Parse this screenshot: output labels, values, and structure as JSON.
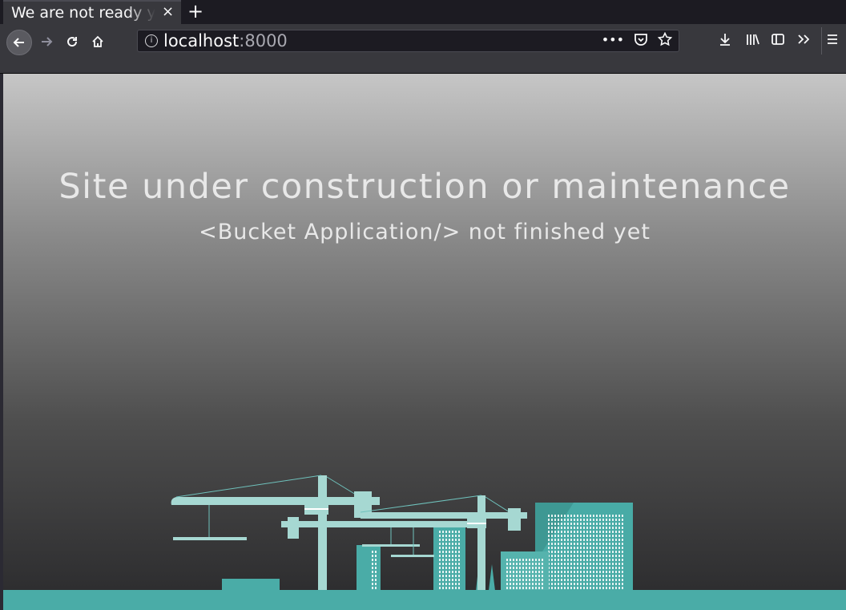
{
  "browser": {
    "tab_title": "We are not ready yet",
    "tab_close": "×",
    "new_tab": "+",
    "url_host": "localhost",
    "url_port": ":8000"
  },
  "page": {
    "headline": "Site under construction or maintenance",
    "subline": "<Bucket Application/> not finished yet"
  },
  "colors": {
    "teal": "#4aaca7",
    "teal_light": "#a6d8d2",
    "chrome_dark": "#38383d"
  },
  "icons": [
    "back-arrow-icon",
    "forward-arrow-icon",
    "reload-icon",
    "home-icon",
    "info-icon",
    "more-icon",
    "pocket-icon",
    "bookmark-star-icon",
    "download-icon",
    "library-icon",
    "sidebar-icon",
    "overflow-icon",
    "hamburger-menu-icon"
  ]
}
